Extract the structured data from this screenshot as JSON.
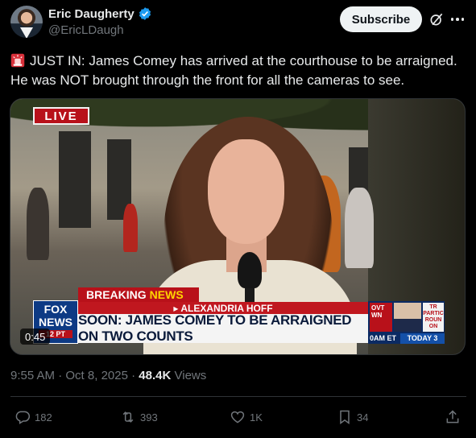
{
  "author": {
    "display_name": "Eric Daugherty",
    "handle": "@EricLDaugh"
  },
  "header": {
    "subscribe_label": "Subscribe",
    "grok_icon": "grok-icon",
    "more_icon": "more-icon"
  },
  "tweet": {
    "emoji_icon": "siren-icon",
    "text": "JUST IN: James Comey has arrived at the courthouse to be arraigned. He was NOT brought through the front for all the cameras to see."
  },
  "video": {
    "live_label": "LIVE",
    "breaking_label": "BREAKING",
    "breaking_news_label": "NEWS",
    "reporter": "▸ ALEXANDRIA HOFF",
    "headline": "SOON: JAMES COMEY TO BE ARRAIGNED ON TWO COUNTS",
    "logo_line1": "FOX",
    "logo_line2": "NEWS",
    "logo_time": "12 PT",
    "side_text_1": "OVT WN",
    "side_text_2": "TR PARTIC ROUN ON",
    "side_bottom_1": "0AM ET",
    "side_bottom_2": "TODAY 3",
    "duration": "0:45"
  },
  "meta": {
    "time": "9:55 AM",
    "separator": " · ",
    "date": "Oct 8, 2025",
    "views_count": "48.4K",
    "views_label": "Views"
  },
  "actions": {
    "replies": "182",
    "reposts": "393",
    "likes": "1K",
    "bookmarks": "34"
  },
  "colors": {
    "background": "#000000",
    "text": "#e7e9ea",
    "secondary": "#71767b",
    "verified": "#1d9bf0",
    "fox_red": "#b8111a",
    "fox_blue": "#0d3a84"
  }
}
